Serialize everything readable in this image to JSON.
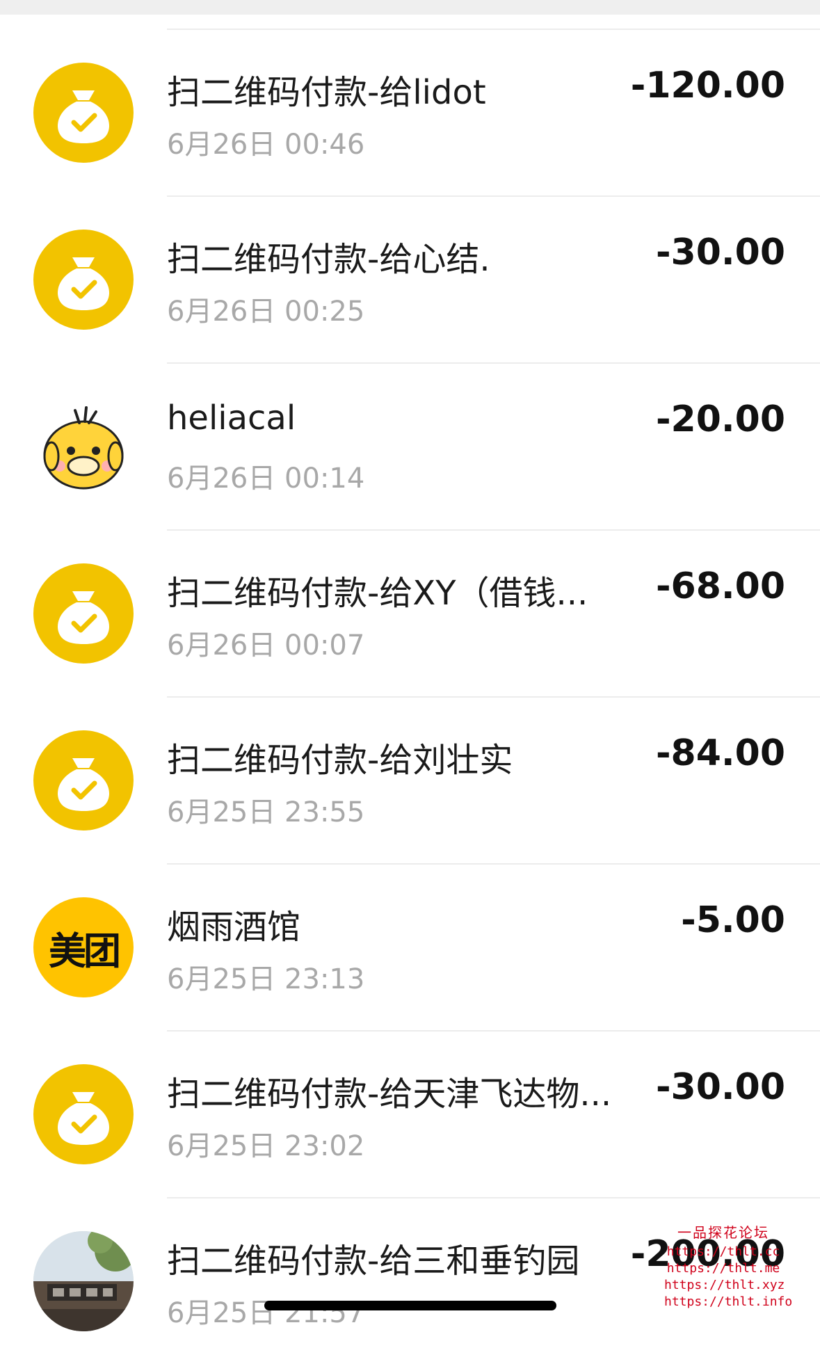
{
  "transactions": [
    {
      "avatar": "money-bag-icon",
      "title": "扫二维码付款-给lidot",
      "time": "6月26日 00:46",
      "amount": "-120.00"
    },
    {
      "avatar": "money-bag-icon",
      "title": "扫二维码付款-给心结.",
      "time": "6月26日 00:25",
      "amount": "-30.00"
    },
    {
      "avatar": "duck-avatar",
      "title": "heliacal",
      "time": "6月26日 00:14",
      "amount": "-20.00"
    },
    {
      "avatar": "money-bag-icon",
      "title": "扫二维码付款-给XY（借钱...",
      "time": "6月26日 00:07",
      "amount": "-68.00"
    },
    {
      "avatar": "money-bag-icon",
      "title": "扫二维码付款-给刘壮实",
      "time": "6月25日 23:55",
      "amount": "-84.00"
    },
    {
      "avatar": "meituan-logo",
      "avatar_text": "美团",
      "title": "烟雨酒馆",
      "time": "6月25日 23:13",
      "amount": "-5.00"
    },
    {
      "avatar": "money-bag-icon",
      "title": "扫二维码付款-给天津飞达物...",
      "time": "6月25日 23:02",
      "amount": "-30.00"
    },
    {
      "avatar": "store-photo-avatar",
      "title": "扫二维码付款-给三和垂钓园",
      "time": "6月25日 21:57",
      "amount": "-200.00"
    }
  ],
  "watermark": {
    "title": "一品探花论坛",
    "lines": [
      "https://thlt.cc",
      "https://thlt.me",
      "https://thlt.xyz",
      "https://thlt.info"
    ]
  },
  "colors": {
    "accent": "#f2c300",
    "meituan": "#ffc300",
    "amount": "#111111",
    "time": "#a8a8a8"
  }
}
